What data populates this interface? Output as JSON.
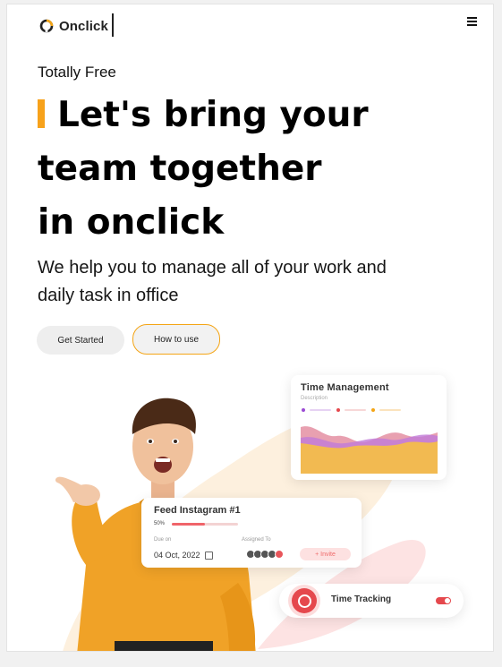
{
  "header": {
    "logo_text": "Onclick",
    "logo_icon": "onclick-logo-icon",
    "menu_icon": "hamburger-menu-icon"
  },
  "hero": {
    "eyebrow": "Totally Free",
    "title_line_1": "Let's bring your",
    "title_line_2": "team together",
    "title_line_3": "in onclick",
    "subtitle": "We help you to manage all of your work and daily task in office",
    "accent_color": "#f7a21b"
  },
  "actions": {
    "get_started_label": "Get Started",
    "how_to_use_label": "How to use"
  },
  "cards": {
    "time_management": {
      "title": "Time Management",
      "description": "Description"
    },
    "feed": {
      "title": "Feed Instagram #1",
      "progress_label": "50%",
      "progress": 0.5,
      "due_label": "Due on",
      "due_date": "04 Oct, 2022",
      "assigned_label": "Assigned To",
      "invite_label": "+ Invite"
    },
    "time_tracking": {
      "label": "Time Tracking",
      "toggle_on": true,
      "icon": "clock-icon"
    }
  },
  "colors": {
    "accent_orange": "#f4a516",
    "brand_red": "#e5484d",
    "blob_peach": "#fdf0de",
    "blob_pink": "#fde3e3"
  }
}
